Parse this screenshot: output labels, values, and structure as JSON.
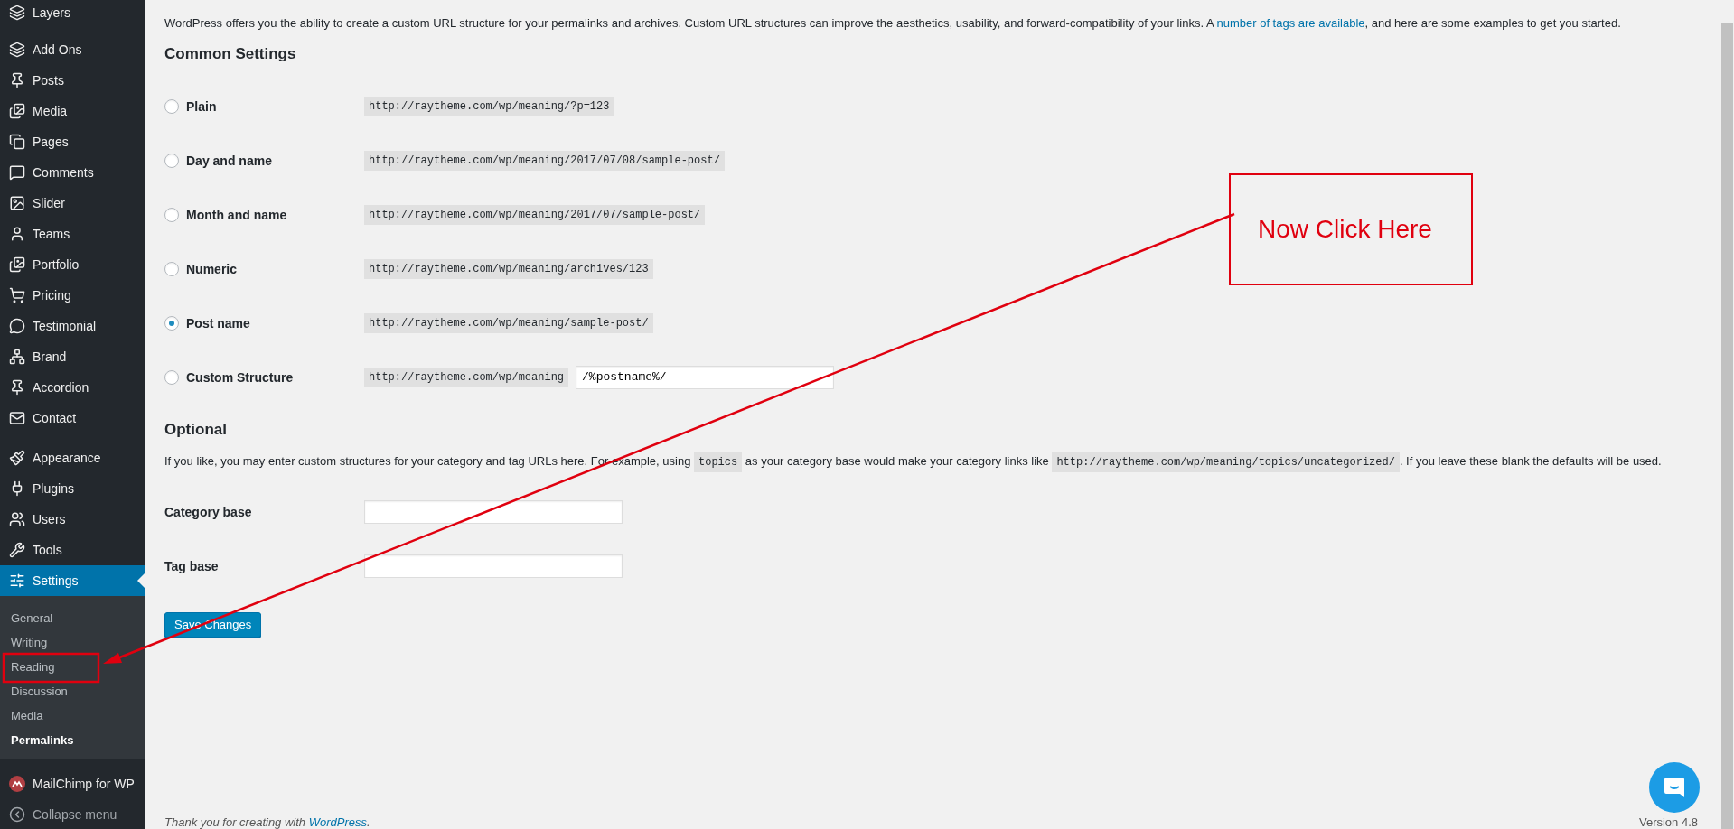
{
  "sidebar": {
    "sections": [
      [
        {
          "label": "Layers",
          "selected": false
        }
      ],
      [
        {
          "label": "Add Ons",
          "selected": false
        },
        {
          "label": "Posts",
          "selected": false
        },
        {
          "label": "Media",
          "selected": false
        },
        {
          "label": "Pages",
          "selected": false
        },
        {
          "label": "Comments",
          "selected": false
        },
        {
          "label": "Slider",
          "selected": false
        },
        {
          "label": "Teams",
          "selected": false
        },
        {
          "label": "Portfolio",
          "selected": false
        },
        {
          "label": "Pricing",
          "selected": false
        },
        {
          "label": "Testimonial",
          "selected": false
        },
        {
          "label": "Brand",
          "selected": false
        },
        {
          "label": "Accordion",
          "selected": false
        },
        {
          "label": "Contact",
          "selected": false
        }
      ],
      [
        {
          "label": "Appearance",
          "selected": false
        },
        {
          "label": "Plugins",
          "selected": false
        },
        {
          "label": "Users",
          "selected": false
        },
        {
          "label": "Tools",
          "selected": false
        },
        {
          "label": "Settings",
          "selected": true,
          "children": [
            {
              "label": "General",
              "selected": false
            },
            {
              "label": "Writing",
              "selected": false
            },
            {
              "label": "Reading",
              "selected": false
            },
            {
              "label": "Discussion",
              "selected": false
            },
            {
              "label": "Media",
              "selected": false
            },
            {
              "label": "Permalinks",
              "selected": true
            }
          ]
        }
      ],
      [
        {
          "label": "MailChimp for WP",
          "selected": false,
          "kind": "menu"
        },
        {
          "label": "Collapse menu",
          "selected": false,
          "kind": "collapse"
        }
      ]
    ]
  },
  "intro": {
    "before": "WordPress offers you the ability to create a custom URL structure for your permalinks and archives. Custom URL structures can improve the aesthetics, usability, and forward-compatibility of your links. A ",
    "link": "number of tags are available",
    "after": ", and here are some examples to get you started."
  },
  "common_settings": {
    "heading": "Common Settings",
    "options": [
      {
        "label": "Plain",
        "selected": false,
        "example": "http://raytheme.com/wp/meaning/?p=123"
      },
      {
        "label": "Day and name",
        "selected": false,
        "example": "http://raytheme.com/wp/meaning/2017/07/08/sample-post/"
      },
      {
        "label": "Month and name",
        "selected": false,
        "example": "http://raytheme.com/wp/meaning/2017/07/sample-post/"
      },
      {
        "label": "Numeric",
        "selected": false,
        "example": "http://raytheme.com/wp/meaning/archives/123"
      },
      {
        "label": "Post name",
        "selected": true,
        "example": "http://raytheme.com/wp/meaning/sample-post/"
      },
      {
        "label": "Custom Structure",
        "selected": false,
        "example": "http://raytheme.com/wp/meaning",
        "value": "/%postname%/"
      }
    ]
  },
  "optional": {
    "heading": "Optional",
    "description": [
      {
        "kind": "text",
        "text": "If you like, you may enter custom structures for your category and tag URLs here. For example, using "
      },
      {
        "kind": "code",
        "text": "topics"
      },
      {
        "kind": "text",
        "text": " as your category base would make your category links like "
      },
      {
        "kind": "code",
        "text": "http://raytheme.com/wp/meaning/topics/uncategorized/"
      },
      {
        "kind": "text",
        "text": ". If you leave these blank the defaults will be used."
      }
    ],
    "fields": [
      {
        "label": "Category base"
      },
      {
        "label": "Tag base"
      }
    ]
  },
  "save_button": "Save Changes",
  "footer": {
    "text": "Thank you for creating with ",
    "link": "WordPress",
    "end": ".",
    "version": "Version 4.8"
  },
  "annotation": {
    "callout": "Now Click Here"
  }
}
